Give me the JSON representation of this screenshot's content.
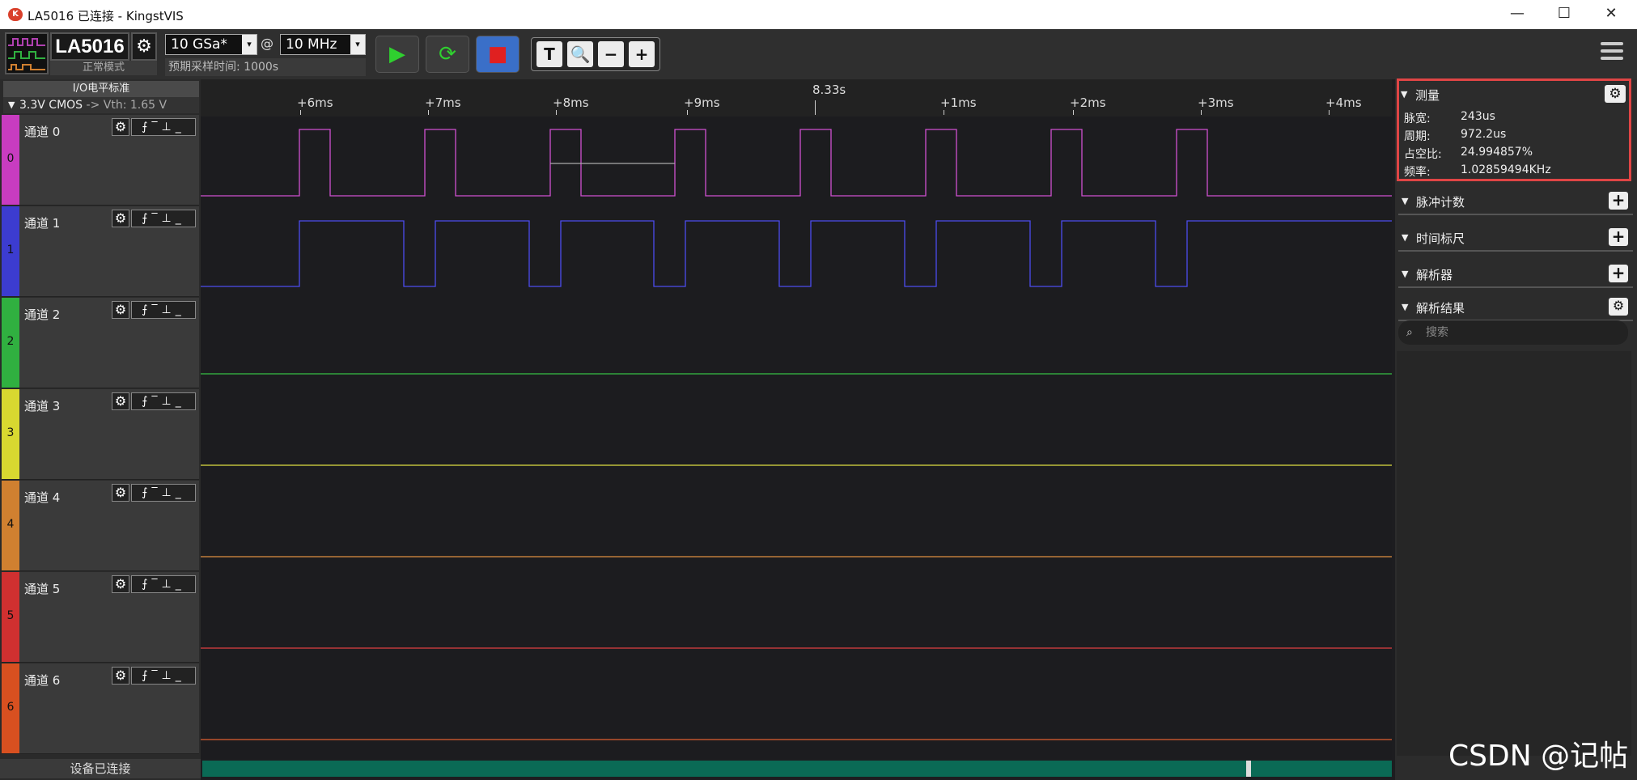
{
  "window": {
    "title": "LA5016 已连接 - KingstVIS",
    "logo": "K",
    "minimize": "—",
    "maximize": "☐",
    "close": "✕"
  },
  "device": {
    "name": "LA5016",
    "mode": "正常模式",
    "gear": "⚙"
  },
  "sampling": {
    "rate": "10 GSa*",
    "at": "@",
    "freq": "10 MHz",
    "estimate": "预期采样时间: 1000s",
    "arrow": "▾"
  },
  "buttons": {
    "start": "▶",
    "restart": "⟳",
    "stop": "■"
  },
  "tools": [
    "T",
    "🔍",
    "−",
    "+"
  ],
  "io": {
    "header": "I/O电平标准",
    "standard": "3.3V CMOS",
    "vth": "-> Vth: 1.65 V",
    "toggle": "▼"
  },
  "channels": [
    {
      "name": "通道 0",
      "num": "0",
      "color": "#c83cc0",
      "trace": "#d050d0"
    },
    {
      "name": "通道 1",
      "num": "1",
      "color": "#3c3cd0",
      "trace": "#4c4cee"
    },
    {
      "name": "通道 2",
      "num": "2",
      "color": "#30b040",
      "trace": "#35c045"
    },
    {
      "name": "通道 3",
      "num": "3",
      "color": "#d8d830",
      "trace": "#e0e040"
    },
    {
      "name": "通道 4",
      "num": "4",
      "color": "#d08030",
      "trace": "#e09040"
    },
    {
      "name": "通道 5",
      "num": "5",
      "color": "#d03030",
      "trace": "#e04040"
    },
    {
      "name": "通道 6",
      "num": "6",
      "color": "#d85020",
      "trace": "#e06030"
    }
  ],
  "channel_controls": {
    "gear": "⚙",
    "edges": "⨍‾⊥_"
  },
  "ruler": {
    "center": "8.33s",
    "ticks": [
      "+6ms",
      "+7ms",
      "+8ms",
      "+9ms",
      "+1ms",
      "+2ms",
      "+3ms",
      "+4ms"
    ]
  },
  "status": "设备已连接",
  "panel": {
    "measure": {
      "title": "测量",
      "rows": [
        {
          "k": "脉宽:",
          "v": "243us"
        },
        {
          "k": "周期:",
          "v": "972.2us"
        },
        {
          "k": "占空比:",
          "v": "24.994857%"
        },
        {
          "k": "频率:",
          "v": "1.02859494KHz"
        }
      ]
    },
    "sections": [
      "脉冲计数",
      "时间标尺",
      "解析器",
      "解析结果"
    ],
    "search_placeholder": "搜索",
    "toggle": "▼",
    "add": "+",
    "gear": "⚙",
    "search_icon": "⌕"
  },
  "watermark": "CSDN @记帖"
}
